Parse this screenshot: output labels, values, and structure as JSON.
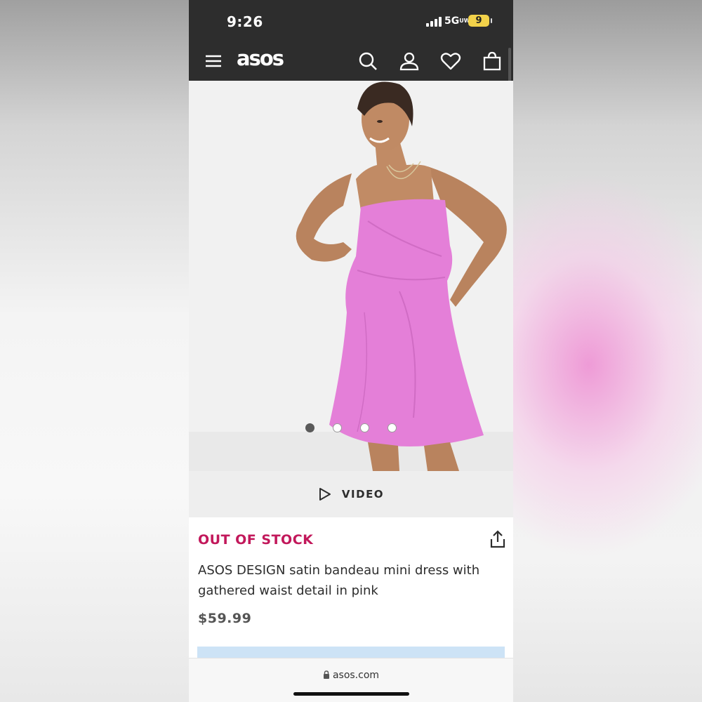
{
  "status_bar": {
    "time": "9:26",
    "network": "5G",
    "network_sub": "UW",
    "battery": "9"
  },
  "nav": {
    "brand": "asos",
    "menu_icon": "hamburger-menu-icon",
    "search_icon": "search-icon",
    "account_icon": "user-icon",
    "wishlist_icon": "heart-icon",
    "bag_icon": "bag-icon"
  },
  "gallery": {
    "image_count": 4,
    "active_index": 0
  },
  "video": {
    "label": "VIDEO"
  },
  "product": {
    "stock_status": "OUT OF STOCK",
    "title": "ASOS DESIGN satin bandeau mini dress with gathered waist detail in pink",
    "price": "$59.99"
  },
  "browser": {
    "url": "asos.com"
  },
  "colors": {
    "header": "#2d2d2d",
    "stock_status": "#c2185b",
    "dress": "#e47fd8",
    "info_box": "#cde3f6"
  }
}
